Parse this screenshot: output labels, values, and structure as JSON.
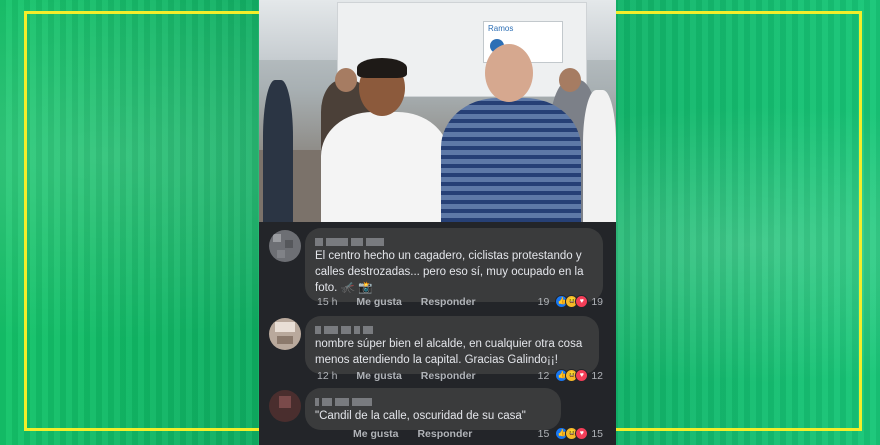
{
  "colors": {
    "background_green": "#12b56a",
    "frame_yellow": "#f3ee2a",
    "bubble": "#3a3b3c",
    "panel": "#232529",
    "like_blue": "#1877f2",
    "haha_yellow": "#f7b928",
    "love_red": "#f33e58"
  },
  "photo": {
    "truck_sign_text": "Ramos"
  },
  "comments": [
    {
      "text": "El centro hecho un cagadero, ciclistas protestando y calles destrozadas... pero eso sí, muy ocupado en la foto. 🦟 📸",
      "time": "15 h",
      "like_label": "Me gusta",
      "reply_label": "Responder",
      "reactions_left": "19",
      "reactions_right": "19",
      "reaction_icons": [
        "like-icon",
        "haha-icon",
        "love-icon"
      ]
    },
    {
      "text": "nombre súper bien el alcalde, en cualquier otra cosa menos atendiendo la capital. Gracias Galindo¡¡!",
      "time": "12 h",
      "like_label": "Me gusta",
      "reply_label": "Responder",
      "reactions_left": "12",
      "reactions_right": "12",
      "reaction_icons": [
        "like-icon",
        "haha-icon",
        "love-icon"
      ]
    },
    {
      "text": "\"Candil de la calle, oscuridad de su casa\"",
      "time": "",
      "like_label": "Me gusta",
      "reply_label": "Responder",
      "reactions_left": "15",
      "reactions_right": "15",
      "reaction_icons": [
        "like-icon",
        "haha-icon",
        "love-icon"
      ]
    }
  ]
}
